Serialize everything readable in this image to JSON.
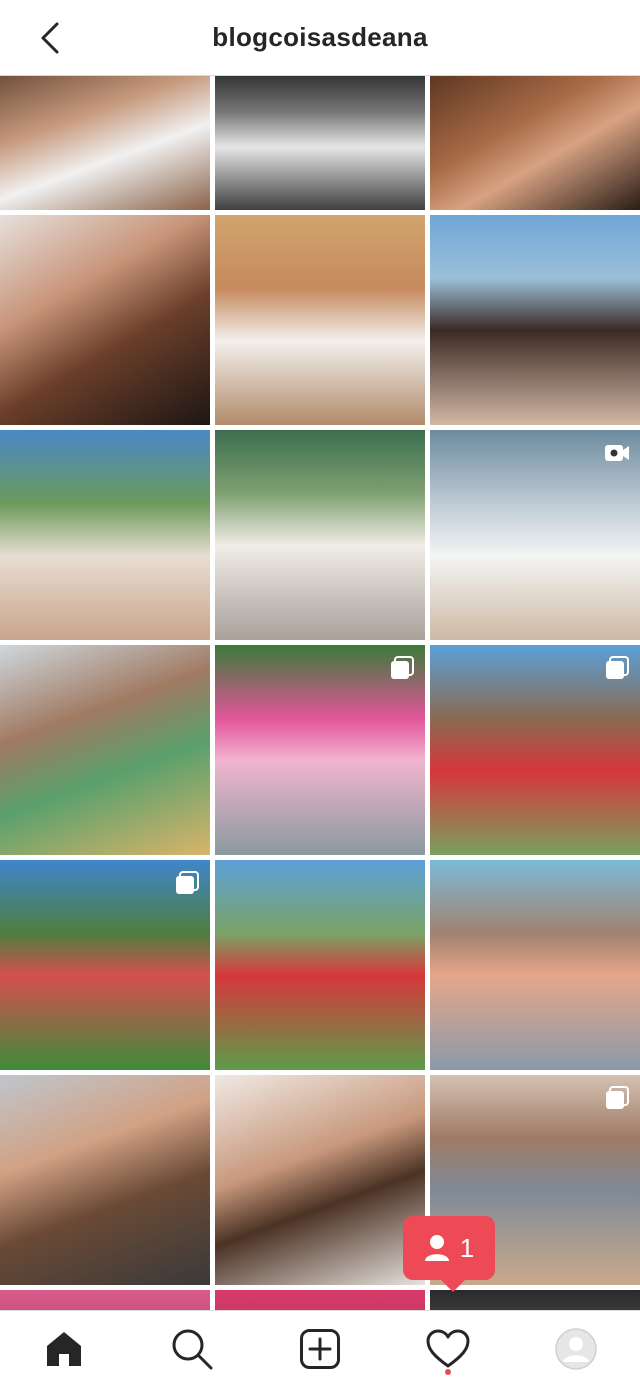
{
  "header": {
    "title": "blogcoisasdeana"
  },
  "notification": {
    "count": "1"
  },
  "grid": {
    "tiles": [
      {
        "bg": "linear-gradient(160deg,#6b4a36 0%,#c79a7e 35%,#f1f1f1 60%,#8a6248 100%)",
        "badge": "none"
      },
      {
        "bg": "linear-gradient(180deg,#2a2a2a 0%,#777 30%,#e6e6e6 55%,#404040 100%)",
        "badge": "none"
      },
      {
        "bg": "linear-gradient(150deg,#5a3420 0%,#a86b47 40%,#d7a282 60%,#2a1c16 100%)",
        "badge": "none"
      },
      {
        "bg": "linear-gradient(150deg,#e6e0dc 0%,#c89479 35%,#6b3f2a 60%,#1d1614 100%)",
        "badge": "none"
      },
      {
        "bg": "linear-gradient(180deg,#d2a46e 0%,#c58a5d 35%,#f3f0ed 60%,#b08b6a 100%)",
        "badge": "none"
      },
      {
        "bg": "linear-gradient(180deg,#6fa6d6 0%,#9ac0da 30%,#3b2a24 55%,#d2b8a6 100%)",
        "badge": "none"
      },
      {
        "bg": "linear-gradient(180deg,#4a88c8 0%,#6b9a5a 35%,#e8ddd3 60%,#c8a58a 100%)",
        "badge": "none"
      },
      {
        "bg": "linear-gradient(180deg,#3c6e50 0%,#7fa070 30%,#f0ece6 55%,#a9a09a 100%)",
        "badge": "none"
      },
      {
        "bg": "linear-gradient(180deg,#6e8ba0 0%,#c9d4dc 40%,#f4f4f4 60%,#cdb9a5 100%)",
        "badge": "video"
      },
      {
        "bg": "linear-gradient(160deg,#cfd7dd 0%,#a07a62 35%,#5aa06c 60%,#d9b46a 100%)",
        "badge": "none"
      },
      {
        "bg": "linear-gradient(180deg,#3b7a3a 0%,#e2559a 35%,#f1b4cf 55%,#8a9a9e 100%)",
        "badge": "multi"
      },
      {
        "bg": "linear-gradient(180deg,#5aa0d8 0%,#8a6a52 35%,#d7373b 60%,#79a05e 100%)",
        "badge": "multi"
      },
      {
        "bg": "linear-gradient(180deg,#3f86cc 0%,#4f7d3f 35%,#d45050 55%,#3f8a3a 100%)",
        "badge": "multi"
      },
      {
        "bg": "linear-gradient(180deg,#5da0d8 0%,#7aa366 35%,#d6373b 55%,#5d9c4a 100%)",
        "badge": "none"
      },
      {
        "bg": "linear-gradient(180deg,#7cbad8 0%,#a08270 35%,#e6a68a 55%,#8a9aa8 100%)",
        "badge": "none"
      },
      {
        "bg": "linear-gradient(160deg,#bfc6cc 0%,#d1a184 35%,#6b4a36 60%,#3a3a3a 100%)",
        "badge": "none"
      },
      {
        "bg": "linear-gradient(160deg,#efe9e4 0%,#c8987c 40%,#4b3224 60%,#e7e2de 100%)",
        "badge": "none"
      },
      {
        "bg": "linear-gradient(180deg,#d4c2b3 0%,#a07a66 30%,#7f8a96 55%,#caa98c 100%)",
        "badge": "multi"
      },
      {
        "bg": "linear-gradient(180deg,#d85c8a 0%,#b04070 100%)",
        "badge": "none"
      },
      {
        "bg": "linear-gradient(180deg,#d83b6a 0%,#b83060 100%)",
        "badge": "none"
      },
      {
        "bg": "linear-gradient(180deg,#2a2a2a 0%,#555 100%)",
        "badge": "none"
      }
    ]
  },
  "colors": {
    "accent": "#ed4956",
    "text": "#262626",
    "divider": "#dbdbdb"
  },
  "icons": {
    "back": "chevron-left-icon",
    "home": "home-icon",
    "search": "search-icon",
    "new_post": "plus-square-icon",
    "activity": "heart-icon",
    "profile": "avatar"
  }
}
